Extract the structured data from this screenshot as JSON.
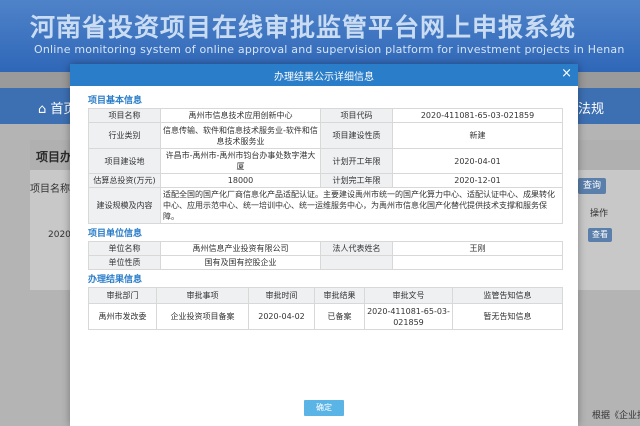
{
  "site": {
    "title": "河南省投资项目在线审批监管平台网上申报系统",
    "subtitle": "Online monitoring system of online approval and supervision platform for investment projects in Henan",
    "nav_home": "首页",
    "nav_right": "法规",
    "panel_title": "项目办理",
    "label_project_name": "项目名称：",
    "query_button": "查询",
    "op_header": "操作",
    "year_text": "2020",
    "view_button": "查看",
    "bottom_right_text": "根据《企业投"
  },
  "modal": {
    "title": "办理结果公示详细信息",
    "close": "×",
    "ok_button": "确定",
    "basic_info": {
      "section_title": "项目基本信息",
      "rows": [
        {
          "l1": "项目名称",
          "v1": "禹州市信息技术应用创新中心",
          "l2": "项目代码",
          "v2": "2020-411081-65-03-021859"
        },
        {
          "l1": "行业类别",
          "v1": "信息传输、软件和信息技术服务业-软件和信息技术服务业",
          "l2": "项目建设性质",
          "v2": "新建"
        },
        {
          "l1": "项目建设地",
          "v1": "许昌市-禹州市-禹州市钧台办事处数字港大厦",
          "l2": "计划开工年限",
          "v2": "2020-04-01"
        },
        {
          "l1": "估算总投资(万元)",
          "v1": "18000",
          "l2": "计划完工年限",
          "v2": "2020-12-01"
        }
      ],
      "scale_label": "建设规模及内容",
      "scale_value": "适配全国的国产化厂商信息化产品适配认证。主要建设禹州市统一的国产化算力中心、适配认证中心、成果转化中心、应用示范中心、统一培训中心、统一运维服务中心，为禹州市信息化国产化替代提供技术支撑和服务保障。"
    },
    "unit_info": {
      "section_title": "项目单位信息",
      "unit_name_label": "单位名称",
      "unit_name": "禹州信息产业投资有限公司",
      "legal_rep_label": "法人代表姓名",
      "legal_rep": "王刚",
      "unit_nature_label": "单位性质",
      "unit_nature": "国有及国有控股企业"
    },
    "result_info": {
      "section_title": "办理结果信息",
      "headers": [
        "审批部门",
        "审批事项",
        "审批时间",
        "审批结果",
        "审批文号",
        "监管告知信息"
      ],
      "row": [
        "禹州市发改委",
        "企业投资项目备案",
        "2020-04-02",
        "已备案",
        "2020-411081-65-03-021859",
        "暂无告知信息"
      ]
    }
  }
}
